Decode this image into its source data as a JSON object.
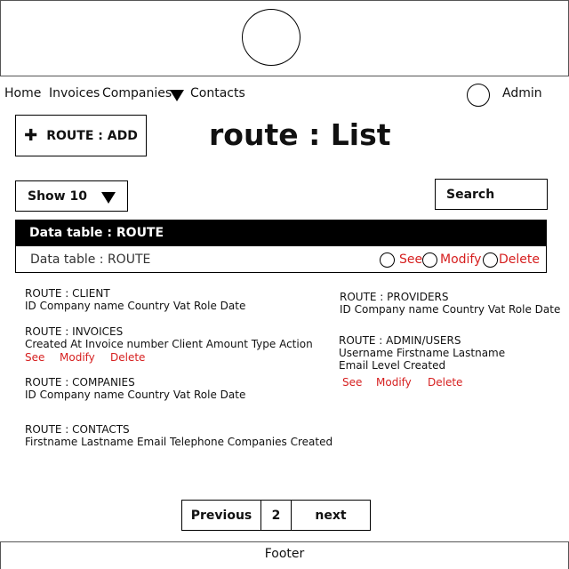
{
  "nav": {
    "items": [
      "Home",
      "Invoices",
      "Companies",
      "Contacts"
    ],
    "user": "Admin"
  },
  "toolbar": {
    "add_label": "ROUTE : ADD",
    "page_title": "route : List",
    "show_label": "Show 10",
    "search_label": "Search"
  },
  "table": {
    "header": "Data table : ROUTE",
    "row_label": "Data table : ROUTE",
    "actions": [
      "See",
      "Modify",
      "Delete"
    ]
  },
  "routes": {
    "client": {
      "title": "ROUTE : CLIENT",
      "fields": "ID Company name Country Vat Role Date"
    },
    "invoices": {
      "title": "ROUTE : INVOICES",
      "fields": "Created At Invoice number Client Amount Type Action",
      "actions": [
        "See",
        "Modify",
        "Delete"
      ]
    },
    "companies": {
      "title": "ROUTE : COMPANIES",
      "fields": "ID Company name Country Vat Role Date"
    },
    "contacts": {
      "title": "ROUTE : CONTACTS",
      "fields": "Firstname Lastname Email Telephone Companies Created"
    },
    "providers": {
      "title": "ROUTE : PROVIDERS",
      "fields": "ID Company name Country Vat Role Date"
    },
    "admin_users": {
      "title": "ROUTE : ADMIN/USERS",
      "fields_line1": "Username Firstname Lastname",
      "fields_line2": "Email Level Created",
      "actions": [
        "See",
        "Modify",
        "Delete"
      ]
    }
  },
  "pagination": {
    "previous": "Previous",
    "page": "2",
    "next": "next"
  },
  "footer": {
    "label": "Footer"
  },
  "colors": {
    "action_red": "#d61f1f"
  }
}
